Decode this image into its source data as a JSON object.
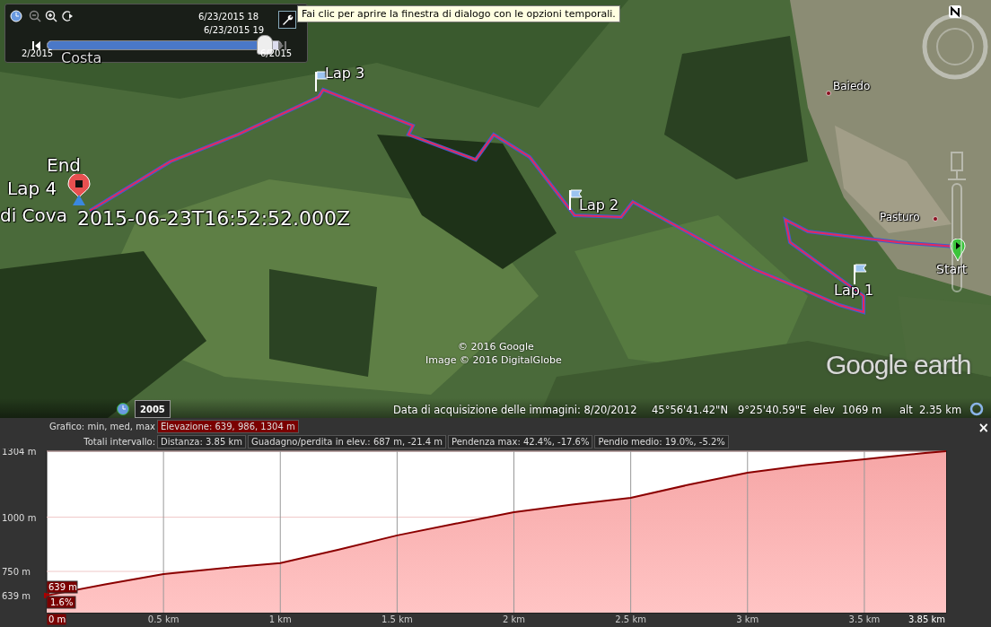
{
  "time_slider": {
    "dates": [
      "6/23/2015  18",
      "6/23/2015  19"
    ],
    "start": "2/2015",
    "end": "6/2015",
    "level": 0.93
  },
  "tooltip": "Fai clic per aprire la finestra di dialogo con le opzioni temporali.",
  "map": {
    "kind": "picture",
    "places": [
      {
        "label": "Costa"
      },
      {
        "label": "Baiedo"
      },
      {
        "label": "Pasturo"
      },
      {
        "label": "di Cova"
      }
    ],
    "placemarks": [
      {
        "kind": "flag",
        "label": "Lap 3"
      },
      {
        "kind": "flag",
        "label": "Lap 2"
      },
      {
        "kind": "flag",
        "label": "Lap 1"
      },
      {
        "kind": "flag",
        "label": "Lap 4"
      },
      {
        "kind": "start",
        "label": "Start"
      },
      {
        "kind": "end",
        "label": "End"
      }
    ],
    "timestamp": "2015-06-23T16:52:52.000Z",
    "attribution": [
      "© 2016 Google",
      "Image © 2016 DigitalGlobe"
    ],
    "logo": "Google earth",
    "history_year": "2005"
  },
  "status_bar": {
    "acquisition": "Data di acquisizione delle immagini: 8/20/2012",
    "lat": "45°56'41.42\"N",
    "lon": "9°25'40.59\"E",
    "elev_label": "elev",
    "elev": "1069 m",
    "alt_label": "alt",
    "alt": "2.35 km"
  },
  "profile": {
    "graph_label": "Grafico: min, med, max",
    "graph_value": "Elevazione: 639, 986, 1304 m",
    "totals_label": "Totali intervallo:",
    "totals": [
      "Distanza: 3.85 km",
      "Guadagno/perdita in elev.: 687 m, -21.4 m",
      "Pendenza max: 42.4%, -17.6%",
      "Pendio medio: 19.0%, -5.2%"
    ],
    "close": "×",
    "cursor": {
      "elev": "639 m",
      "slope": "1.6%",
      "distance": "0 m"
    },
    "chart_data": {
      "type": "area",
      "grid": true,
      "x": [
        0,
        0.25,
        0.5,
        0.75,
        1,
        1.25,
        1.5,
        1.75,
        2,
        2.25,
        2.5,
        2.75,
        3,
        3.25,
        3.5,
        3.75,
        3.85
      ],
      "series": [
        {
          "color": "#8b0000",
          "values": [
            639,
            690,
            738,
            765,
            788,
            850,
            916,
            970,
            1023,
            1058,
            1089,
            1150,
            1205,
            1240,
            1267,
            1295,
            1304
          ]
        }
      ],
      "xlim": [
        0,
        3.85
      ],
      "ylim": [
        560,
        1304
      ],
      "xticks": [
        {
          "value": 0.5,
          "label": "0.5 km"
        },
        {
          "value": 1,
          "label": "1 km"
        },
        {
          "value": 1.5,
          "label": "1.5 km"
        },
        {
          "value": 2,
          "label": "2 km"
        },
        {
          "value": 2.5,
          "label": "2.5 km"
        },
        {
          "value": 3,
          "label": "3 km"
        },
        {
          "value": 3.5,
          "label": "3.5 km"
        },
        {
          "value": 3.85,
          "label": "3.85 km"
        }
      ],
      "yticks": [
        {
          "value": 639,
          "label": "639 m"
        },
        {
          "value": 750,
          "label": "750 m"
        },
        {
          "value": 1000,
          "label": "1000 m"
        },
        {
          "value": 1304,
          "label": "1304 m"
        }
      ]
    }
  }
}
